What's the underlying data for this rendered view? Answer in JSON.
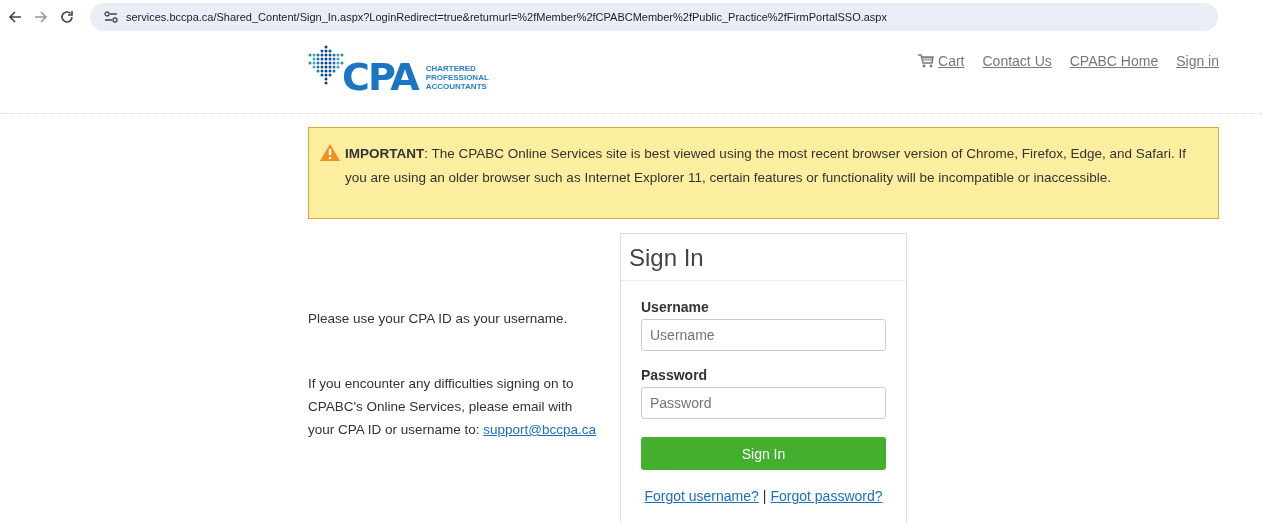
{
  "browser": {
    "url": "services.bccpa.ca/Shared_Content/Sign_In.aspx?LoginRedirect=true&returnurl=%2fMember%2fCPABCMember%2fPublic_Practice%2fFirmPortalSSO.aspx"
  },
  "logo": {
    "mark": "CPA",
    "lines": [
      "CHARTERED",
      "PROFESSIONAL",
      "ACCOUNTANTS"
    ]
  },
  "nav": [
    {
      "label": "Cart",
      "kind": "cart"
    },
    {
      "label": "Contact Us",
      "kind": "plain"
    },
    {
      "label": "CPABC Home",
      "kind": "plain"
    },
    {
      "label": "Sign in",
      "kind": "plain"
    }
  ],
  "alert": {
    "text": "**IMPORTANT**: The CPABC Online Services site is best viewed using the most recent browser version of Chrome, Firefox, Edge, and Safari. If you are using an older browser such as Internet Explorer 11, certain features or functionality will be incompatible or inaccessible."
  },
  "info": {
    "username_note": "Please use your CPA ID as your username.",
    "help_text": "If you encounter any difficulties signing on to CPABC's Online Services, please email with your CPA ID or username to:",
    "help_link": "support@bccpa.ca"
  },
  "sign_in": {
    "title": "Sign In",
    "fields": [
      {
        "label": "Username",
        "placeholder": "Username"
      },
      {
        "label": "Password",
        "placeholder": "Password"
      }
    ],
    "button": "Sign In",
    "links": [
      "Forgot username?",
      "Forgot password?"
    ],
    "separator": "|"
  }
}
